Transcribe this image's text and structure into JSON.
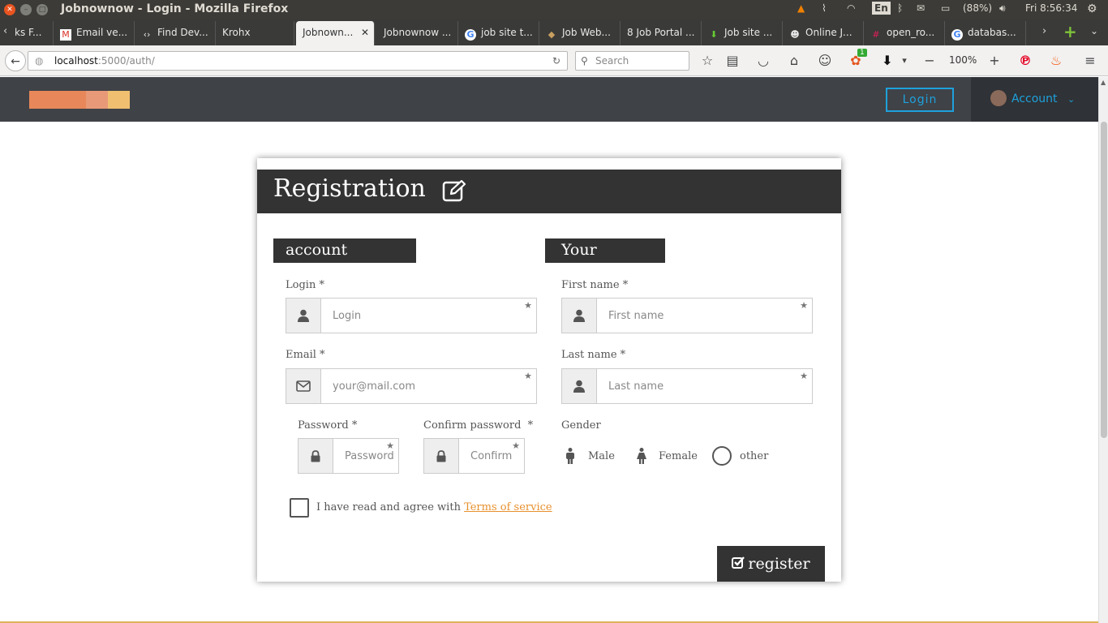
{
  "window": {
    "title": "Jobnownow - Login - Mozilla Firefox"
  },
  "tray": {
    "lang": "En",
    "battery": "(88%)",
    "clock": "Fri  8:56:34"
  },
  "tabs": [
    {
      "label": "ks F..."
    },
    {
      "label": "Email ve..."
    },
    {
      "label": "Find Dev..."
    },
    {
      "label": "Krohx"
    },
    {
      "label": "Jobnown..."
    },
    {
      "label": "Jobnownow ..."
    },
    {
      "label": "job site t..."
    },
    {
      "label": "Job Web..."
    },
    {
      "label": "8 Job Portal ..."
    },
    {
      "label": "Job site ..."
    },
    {
      "label": "Online J..."
    },
    {
      "label": "open_ro..."
    },
    {
      "label": "databas..."
    }
  ],
  "nav": {
    "url_host": "localhost",
    "url_rest": ":5000/auth/",
    "search_placeholder": "Search",
    "zoom": "100%",
    "badge": "1"
  },
  "header": {
    "login": "Login",
    "account": "Account",
    "logo_colors": [
      "#e8875a",
      "#e89a78",
      "#f0c070"
    ]
  },
  "form": {
    "title": "Registration",
    "account_section": "account details",
    "details_section": "Your details",
    "login_label": "Login *",
    "login_placeholder": "Login",
    "email_label": "Email *",
    "email_placeholder": "your@mail.com",
    "password_label": "Password *",
    "password_placeholder": "Password",
    "confirm_label": "Confirm password  *",
    "confirm_placeholder": "Confirm",
    "firstname_label": "First name *",
    "firstname_placeholder": "First name",
    "lastname_label": "Last name *",
    "lastname_placeholder": "Last name",
    "gender_label": "Gender",
    "gender_male": "Male",
    "gender_female": "Female",
    "gender_other": "other",
    "terms_text": "I have read and agree with ",
    "terms_link": "Terms of service",
    "register": "register"
  }
}
